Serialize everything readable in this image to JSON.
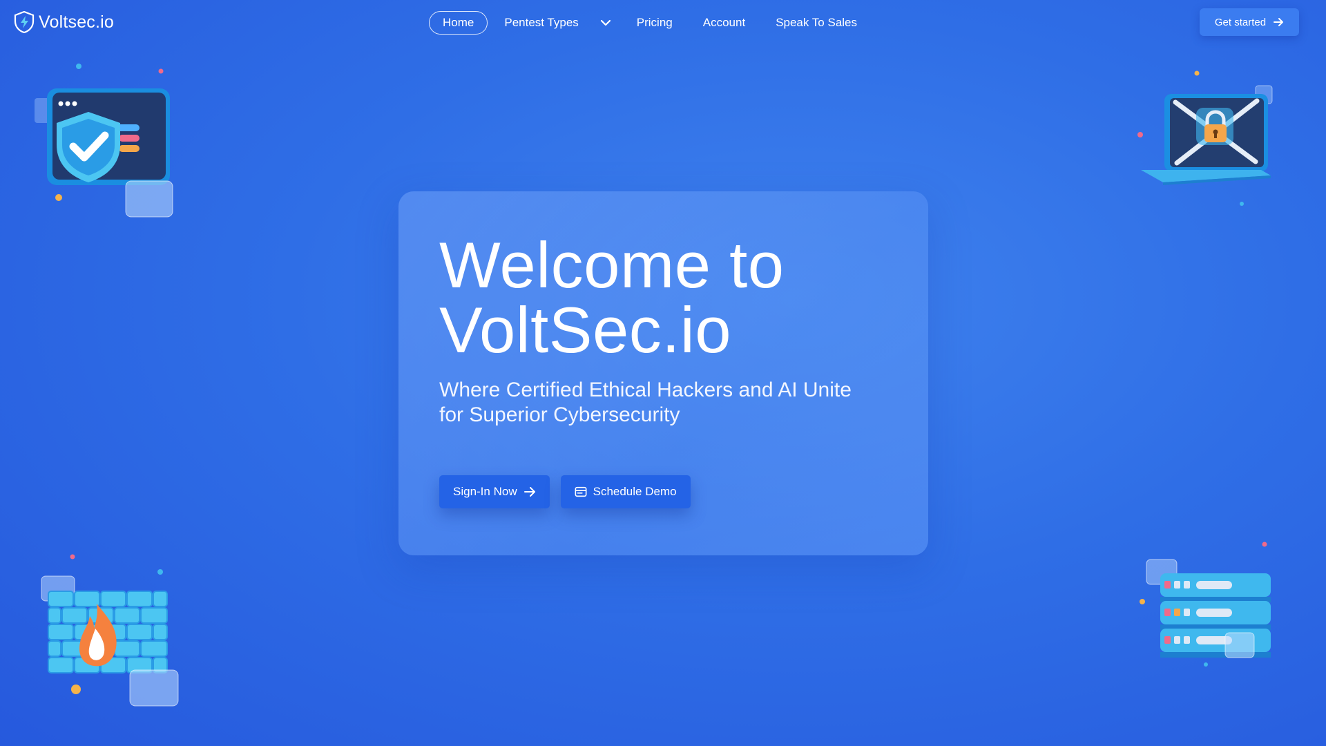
{
  "nav": {
    "brand": "Voltsec.io",
    "links": {
      "home": "Home",
      "pentest_types": "Pentest Types",
      "pricing": "Pricing",
      "account": "Account",
      "speak_to_sales": "Speak To Sales"
    },
    "cta": "Get started"
  },
  "hero": {
    "title_line1": "Welcome to",
    "title_line2": "VoltSec.io",
    "subtitle_line1": "Where Certified Ethical Hackers and AI Unite",
    "subtitle_line2": "for Superior Cybersecurity",
    "primary_button": "Sign-In Now",
    "secondary_button": "Schedule Demo"
  },
  "icons": {
    "logo": "shield-bolt-icon",
    "dropdown": "chevron-down-icon",
    "arrow": "arrow-right-icon",
    "calendar": "calendar-icon"
  },
  "colors": {
    "background": "#2f6ee6",
    "button": "#2463e6",
    "cta": "#3b7cf0",
    "illustration_cyan": "#3fb8ee",
    "accent_orange": "#f5a64a",
    "accent_pink": "#f06a8a"
  }
}
